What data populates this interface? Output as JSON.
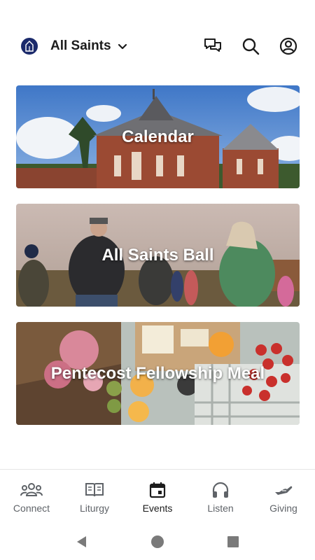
{
  "header": {
    "church_name": "All Saints",
    "logo_icon": "church-logo-icon",
    "actions": [
      "chat-icon",
      "search-icon",
      "account-icon"
    ]
  },
  "cards": [
    {
      "title": "Calendar"
    },
    {
      "title": "All Saints Ball"
    },
    {
      "title": "Pentecost Fellowship Meal"
    }
  ],
  "bottom_nav": [
    {
      "label": "Connect",
      "icon": "people-icon"
    },
    {
      "label": "Liturgy",
      "icon": "book-icon"
    },
    {
      "label": "Events",
      "icon": "calendar-icon",
      "active": true
    },
    {
      "label": "Listen",
      "icon": "headphones-icon"
    },
    {
      "label": "Giving",
      "icon": "giving-hand-icon"
    }
  ],
  "colors": {
    "logo_bg": "#1b2a6b",
    "text": "#1c1c1c",
    "nav_inactive": "#5f6368"
  }
}
